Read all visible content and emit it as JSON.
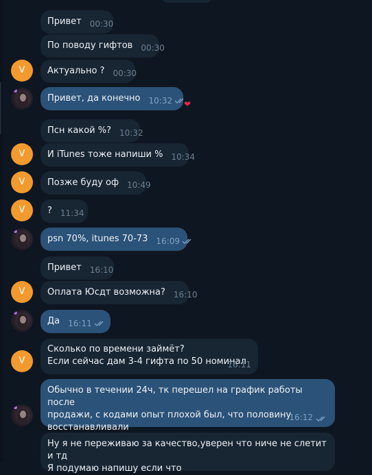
{
  "theme": {
    "background": "#0e1621",
    "incoming": "#182533",
    "outgoing": "#2b5278",
    "avatar_orange": "#f29a2e",
    "heart": "#e0284a"
  },
  "avatars": {
    "contact_initial": "V"
  },
  "messages": [
    {
      "text": "Привет",
      "time": "00:30"
    },
    {
      "text": "По поводу гифтов",
      "time": "00:30"
    },
    {
      "text": "Актуально ?",
      "time": "00:30"
    },
    {
      "text": "Привет, да конечно",
      "time": "10:32",
      "reaction": "❤"
    },
    {
      "text": "Псн какой %?",
      "time": "10:32"
    },
    {
      "text": "И iTunes тоже напиши %",
      "time": "10:34"
    },
    {
      "text": "Позже буду оф",
      "time": "10:49"
    },
    {
      "text": "?",
      "time": "11:34"
    },
    {
      "text": "psn 70%, itunes 70-73",
      "time": "16:09"
    },
    {
      "text": "Привет",
      "time": "16:10"
    },
    {
      "text": "Оплата Юсдт возможна?",
      "time": "16:10"
    },
    {
      "text": "Да",
      "time": "16:11"
    },
    {
      "lines": [
        "Сколько по времени займёт?",
        "Если сейчас дам 3-4 гифта по 50 номинал"
      ],
      "time": "16:11"
    },
    {
      "lines": [
        "Обычно в течении 24ч, тк перешел на график работы после",
        "продажи, с кодами опыт плохой был, что половину",
        "восстанавливали"
      ],
      "time": "16:12"
    },
    {
      "lines": [
        "Ну я не переживаю за качество,уверен что ниче не слетит и тд",
        "Я подумаю напишу если что"
      ]
    }
  ]
}
